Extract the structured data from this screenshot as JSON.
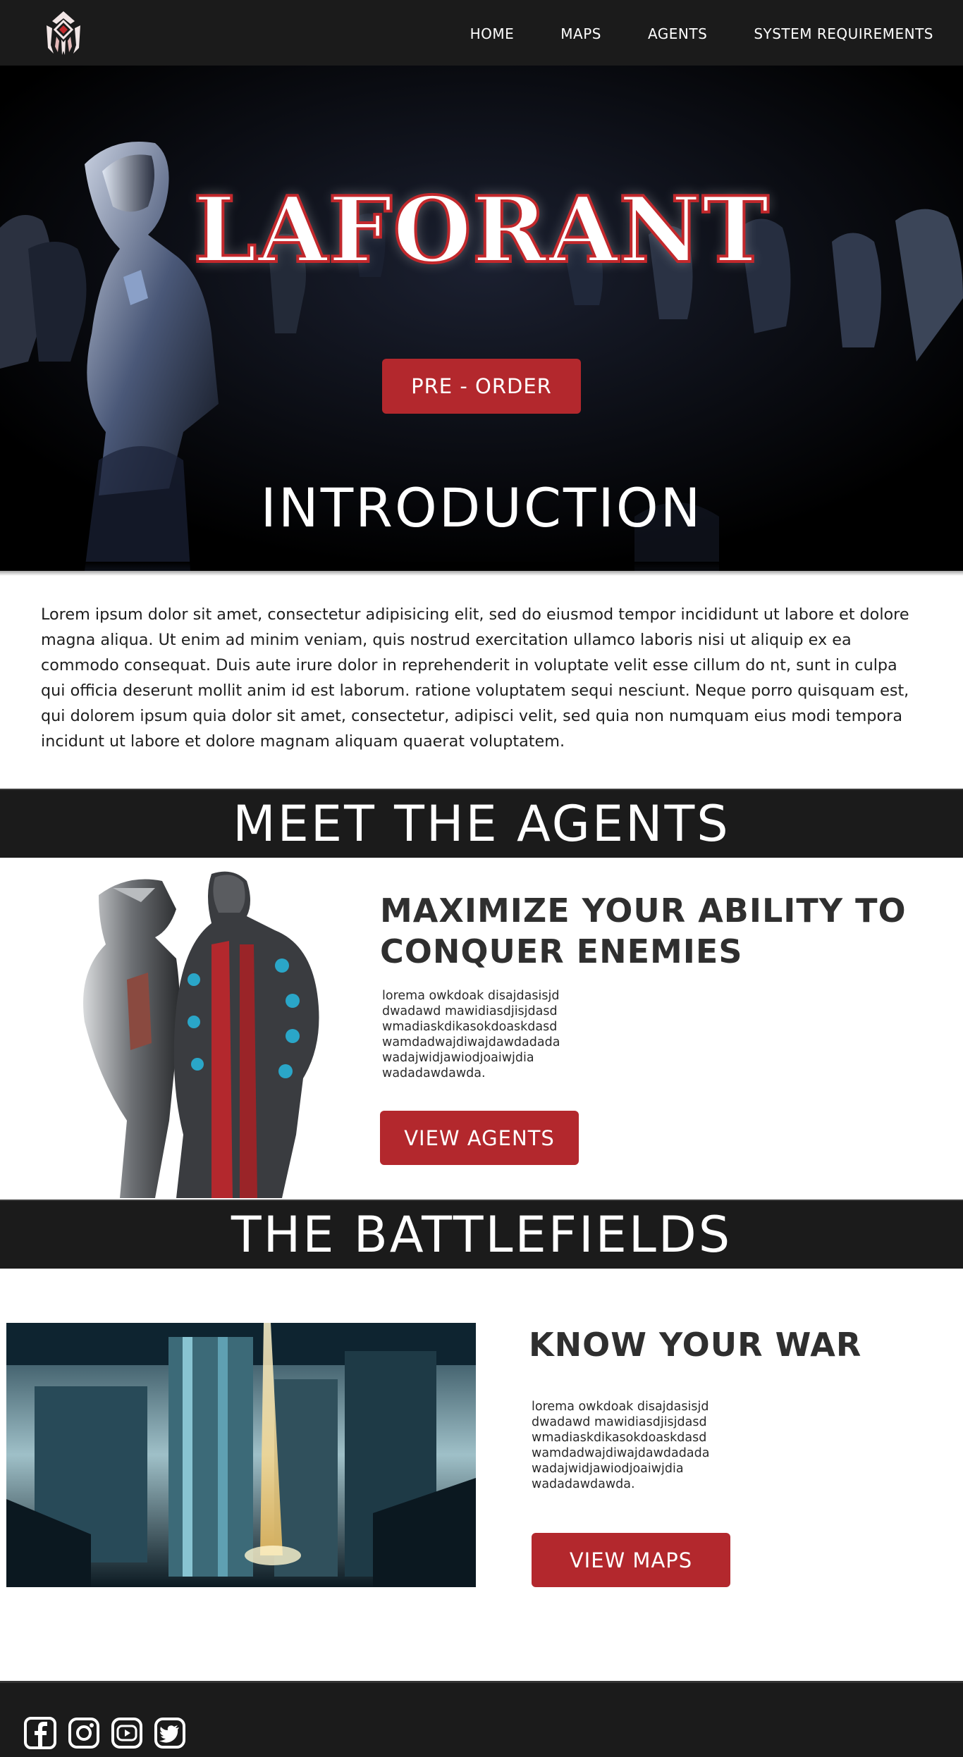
{
  "nav": {
    "logo_icon": "warframe-lotus-logo-icon",
    "links": [
      "HOME",
      "MAPS",
      "AGENTS",
      "SYSTEM REQUIREMENTS"
    ]
  },
  "hero": {
    "title": "LAFORANT",
    "cta_label": "PRE - ORDER",
    "section_title": "INTRODUCTION"
  },
  "intro": {
    "text": "Lorem ipsum dolor sit amet, consectetur adipisicing elit, sed do eiusmod tempor incididunt ut labore et dolore magna aliqua. Ut enim ad minim veniam, quis nostrud exercitation ullamco laboris nisi ut aliquip ex ea commodo consequat. Duis aute irure dolor in reprehenderit in voluptate velit esse cillum do nt, sunt in culpa qui officia deserunt mollit anim id est laborum. ratione voluptatem sequi nesciunt. Neque porro quisquam est, qui dolorem ipsum quia dolor sit amet, consectetur, adipisci velit, sed quia non numquam eius modi tempora incidunt ut labore et dolore magnam aliquam quaerat voluptatem."
  },
  "agents": {
    "band_title": "MEET THE AGENTS",
    "heading_line1": "MAXIMIZE YOUR ABILITY TO",
    "heading_line2": "CONQUER ENEMIES",
    "body_lines": [
      "lorema owkdoak disajdasisjd",
      "dwadawd mawidiasdjisjdasd",
      "wmadiaskdikasokdoaskdasd",
      "wamdadwajdiwajdawdadada",
      "wadajwidjawiodjoaiwjdia",
      "wadadawdawda."
    ],
    "button_label": "VIEW AGENTS"
  },
  "battlefields": {
    "band_title": "THE BATTLEFIELDS",
    "heading": "KNOW YOUR WAR",
    "body_lines": [
      "lorema owkdoak disajdasisjd",
      "dwadawd mawidiasdjisjdasd",
      "wmadiaskdikasokdoaskdasd",
      "wamdadwajdiwajdawdadada",
      "wadajwidjawiodjoaiwjdia",
      "wadadawdawda."
    ],
    "button_label": "VIEW MAPS"
  },
  "footer": {
    "social_icons": [
      "facebook-icon",
      "instagram-icon",
      "youtube-icon",
      "twitter-icon"
    ]
  },
  "colors": {
    "nav_bg": "#1b1b1b",
    "accent_red": "#b3282d",
    "title_stroke": "#c2282c",
    "heading_text": "#2f2f2f"
  }
}
